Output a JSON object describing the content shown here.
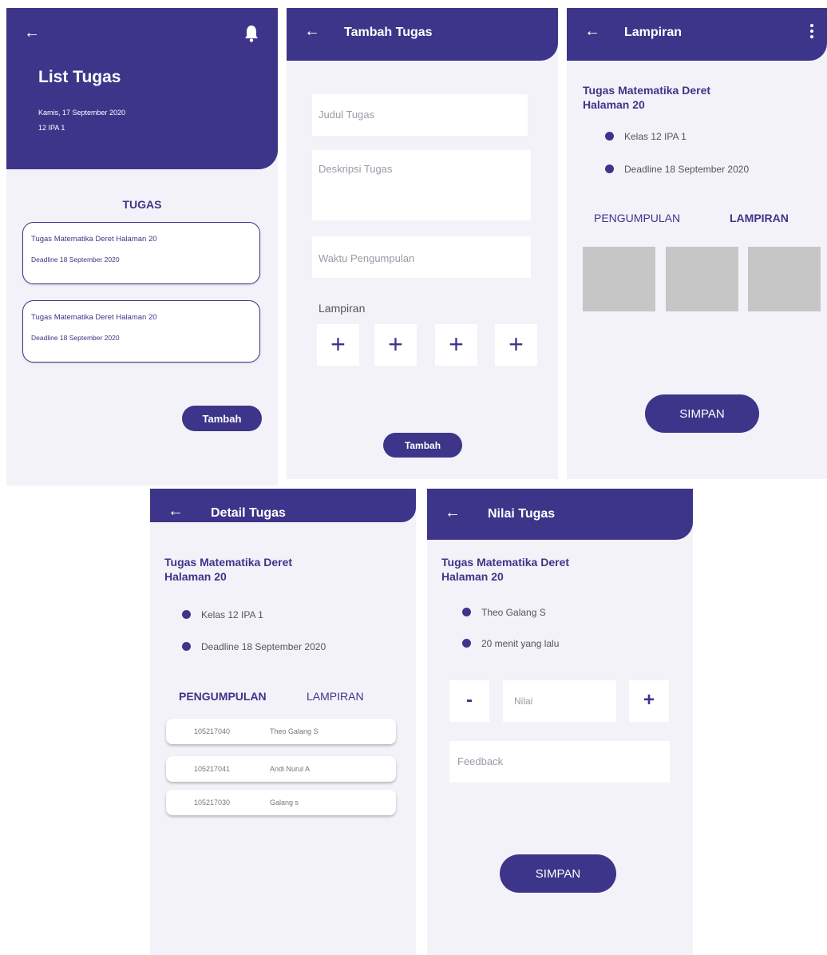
{
  "screen1": {
    "back_icon": "arrow-left-icon",
    "bell_icon": "bell-icon",
    "title": "List Tugas",
    "date": "Kamis, 17 September 2020",
    "class": "12 IPA 1",
    "section_title": "TUGAS",
    "tasks": [
      {
        "title": "Tugas Matematika Deret Halaman 20",
        "deadline": "Deadline 18 September 2020"
      },
      {
        "title": "Tugas Matematika Deret Halaman 20",
        "deadline": "Deadline 18 September 2020"
      }
    ],
    "add_button": "Tambah"
  },
  "screen2": {
    "title": "Tambah Tugas",
    "judul_placeholder": "Judul Tugas",
    "deskripsi_placeholder": "Deskripsi Tugas",
    "waktu_placeholder": "Waktu Pengumpulan",
    "lampiran_label": "Lampiran",
    "plus": "+",
    "add_button": "Tambah"
  },
  "screen3": {
    "title": "Lampiran",
    "menu_icon": "more-vertical-icon",
    "task_title_line1": "Tugas Matematika Deret",
    "task_title_line2": "Halaman 20",
    "kelas": "Kelas 12 IPA 1",
    "deadline": "Deadline 18 September 2020",
    "tab_pengumpulan": "PENGUMPULAN",
    "tab_lampiran": "LAMPIRAN",
    "active_tab": "LAMPIRAN",
    "save_button": "SIMPAN"
  },
  "screen4": {
    "title": "Detail Tugas",
    "task_title_line1": "Tugas Matematika Deret",
    "task_title_line2": "Halaman 20",
    "kelas": "Kelas 12 IPA 1",
    "deadline": "Deadline 18 September 2020",
    "tab_pengumpulan": "PENGUMPULAN",
    "tab_lampiran": "LAMPIRAN",
    "active_tab": "PENGUMPULAN",
    "submissions": [
      {
        "nim": "105217040",
        "name": "Theo Galang S"
      },
      {
        "nim": "105217041",
        "name": "Andi Nurul A"
      },
      {
        "nim": "105217030",
        "name": "Galang s"
      }
    ]
  },
  "screen5": {
    "title": "Nilai Tugas",
    "task_title_line1": "Tugas Matematika Deret",
    "task_title_line2": "Halaman 20",
    "student": "Theo Galang S",
    "time_ago": "20 menit yang lalu",
    "minus": "-",
    "nilai_placeholder": "Nilai",
    "plus": "+",
    "feedback_placeholder": "Feedback",
    "save_button": "SIMPAN"
  },
  "colors": {
    "primary": "#3d3589",
    "background": "#f3f2f8",
    "thumbnail": "#c6c6c6"
  }
}
